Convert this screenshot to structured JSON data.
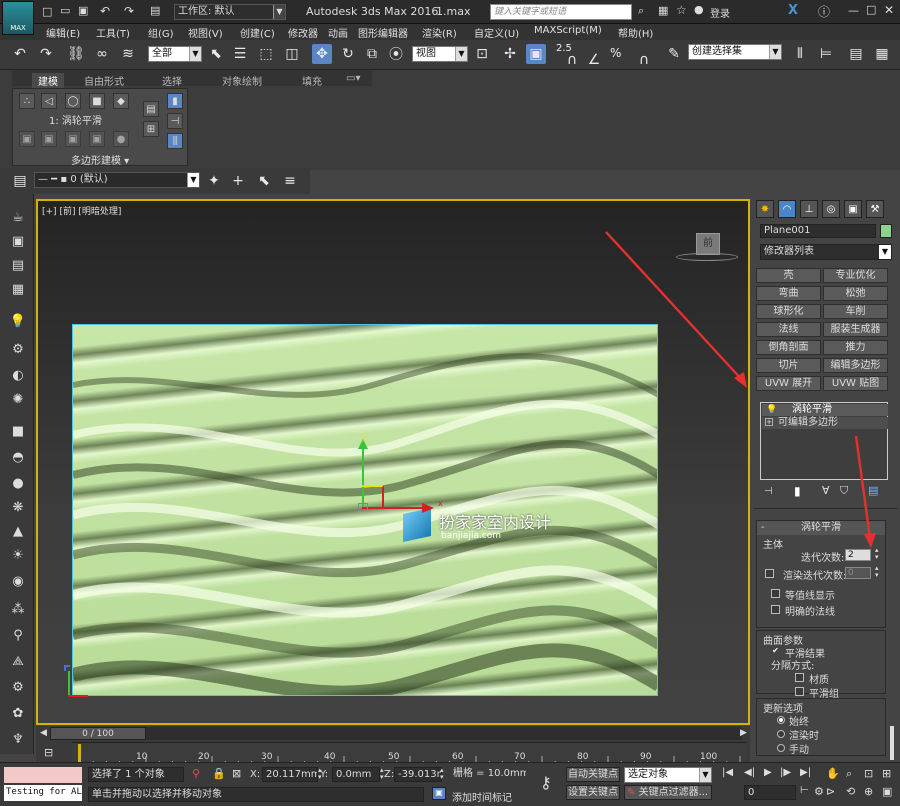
{
  "title_bar": {
    "app_logo": "MAX",
    "workspace": "工作区: 默认",
    "title": "Autodesk 3ds Max 2016",
    "filename": "1.max",
    "search_placeholder": "键入关键字或短语",
    "login": "登录"
  },
  "menu": [
    "编辑(E)",
    "工具(T)",
    "组(G)",
    "视图(V)",
    "创建(C)",
    "修改器",
    "动画",
    "图形编辑器",
    "渲染(R)",
    "自定义(U)",
    "MAXScript(M)",
    "帮助(H)"
  ],
  "toolbar": {
    "filter_select": "全部",
    "ref_coord": "视图",
    "snap_value": "2.5",
    "percent": "%",
    "named_selection": "创建选择集"
  },
  "ribbon": {
    "tabs": [
      "建模",
      "自由形式",
      "选择",
      "对象绘制",
      "填充"
    ],
    "group_label": "1: 涡轮平滑",
    "panel_title": "多边形建模"
  },
  "layer": {
    "name": "0 (默认)"
  },
  "viewport": {
    "label_plus": "[+]",
    "label_view": "[前]",
    "label_shade": "[明暗处理]",
    "viewcube": "前",
    "watermark_title": "扮家家室内设计",
    "watermark_url": "banjiajia.com",
    "axis_x": "x",
    "axis_y": "y"
  },
  "command_panel": {
    "object_name": "Plane001",
    "modifier_list": "修改器列表",
    "modifier_buttons": [
      "壳",
      "专业优化",
      "弯曲",
      "松弛",
      "球形化",
      "车削",
      "法线",
      "服装生成器",
      "倒角剖面",
      "推力",
      "切片",
      "编辑多边形",
      "UVW 展开",
      "UVW 贴图"
    ],
    "stack": [
      "涡轮平滑",
      "可编辑多边形"
    ],
    "rollout_title": "涡轮平滑",
    "main_group": "主体",
    "iterations_label": "迭代次数:",
    "iterations_value": "2",
    "render_iters_label": "渲染迭代次数:",
    "render_iters_value": "0",
    "isoline": "等值线显示",
    "explicit_normals": "明确的法线",
    "surface_group": "曲面参数",
    "smooth_result": "平滑结果",
    "separate_by": "分隔方式:",
    "material": "材质",
    "smoothing_groups": "平滑组",
    "update_group": "更新选项",
    "always": "始终",
    "when_rendering": "渲染时",
    "manual": "手动"
  },
  "timeline": {
    "frame_display": "0 / 100",
    "ticks": [
      "10",
      "20",
      "30",
      "40",
      "50",
      "60",
      "70",
      "80",
      "90",
      "100"
    ]
  },
  "status": {
    "maxscript": "Testing for AL",
    "selected": "选择了 1 个对象",
    "prompt": "单击并拖动以选择并移动对象",
    "x_label": "X:",
    "x_value": "20.117mm",
    "y_label": "Y:",
    "y_value": "0.0mm",
    "z_label": "Z:",
    "z_value": "-39.013mm",
    "grid": "栅格 = 10.0mm",
    "add_time_tag": "添加时间标记",
    "auto_key": "自动关键点",
    "set_key": "设置关键点",
    "selected_object": "选定对象",
    "key_filters": "关键点过滤器...",
    "frame": "0"
  },
  "colors": {
    "accent": "#5a86c5",
    "viewport_border": "#d8b200",
    "plane_edge": "#4bc7e6",
    "annotation": "#e53030",
    "object_color": "#8fd18f"
  }
}
